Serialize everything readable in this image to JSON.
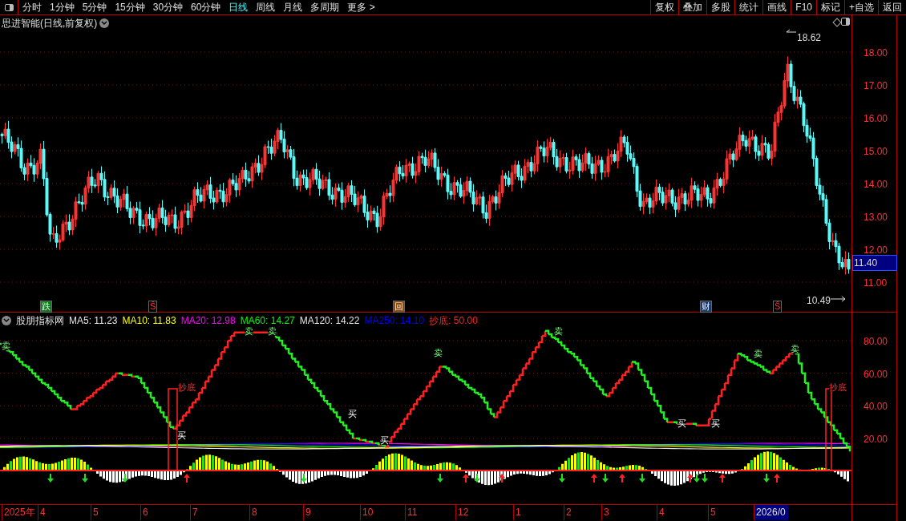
{
  "toolbar": {
    "periods": [
      {
        "label": "分时",
        "selected": false
      },
      {
        "label": "1分钟",
        "selected": false
      },
      {
        "label": "5分钟",
        "selected": false
      },
      {
        "label": "15分钟",
        "selected": false
      },
      {
        "label": "30分钟",
        "selected": false
      },
      {
        "label": "60分钟",
        "selected": false
      },
      {
        "label": "日线",
        "selected": true
      },
      {
        "label": "周线",
        "selected": false
      },
      {
        "label": "月线",
        "selected": false
      },
      {
        "label": "多周期",
        "selected": false
      },
      {
        "label": "更多 >",
        "selected": false
      }
    ],
    "buttons": [
      "复权",
      "叠加",
      "多股",
      "统计",
      "画线",
      "F10",
      "标记",
      "+自选",
      "返回"
    ]
  },
  "price_panel": {
    "title": "思进智能(日线,前复权)",
    "high_label": "18.62",
    "low_label": "10.49",
    "current_price": "11.40",
    "yticks": [
      "18.00",
      "17.00",
      "16.00",
      "15.00",
      "14.00",
      "13.00",
      "12.00",
      "11.00"
    ],
    "markers": [
      {
        "text": "跌",
        "color": "#0a7a1a"
      },
      {
        "text": "Ŝ",
        "color": "#000000"
      },
      {
        "text": "回",
        "color": "#8a4a10"
      },
      {
        "text": "财",
        "color": "#1a3a6a"
      },
      {
        "text": "Ŝ",
        "color": "#000000"
      }
    ]
  },
  "indicator_panel": {
    "name": "股朋指标网",
    "legend": [
      {
        "text": "MA5: 11.23",
        "color": "#e6e6e6"
      },
      {
        "text": "MA10: 11.83",
        "color": "#ffff00"
      },
      {
        "text": "MA20: 12.98",
        "color": "#ff00ff"
      },
      {
        "text": "MA60: 14.27",
        "color": "#00ff00"
      },
      {
        "text": "MA120: 14.22",
        "color": "#e6e6e6"
      },
      {
        "text": "MA250: 14.10",
        "color": "#0000ff"
      },
      {
        "text": "抄底: 50.00",
        "color": "#ff2020"
      }
    ],
    "yticks": [
      "80.00",
      "60.00",
      "40.00",
      "20.00"
    ],
    "signals": [
      {
        "text": "卖",
        "kind": "sell"
      },
      {
        "text": "卖",
        "kind": "sell"
      },
      {
        "text": "卖",
        "kind": "sell"
      },
      {
        "text": "卖",
        "kind": "sell"
      },
      {
        "text": "卖",
        "kind": "sell"
      },
      {
        "text": "卖",
        "kind": "sell"
      },
      {
        "text": "卖",
        "kind": "sell"
      },
      {
        "text": "抄底",
        "kind": "bottom"
      },
      {
        "text": "抄底",
        "kind": "bottom"
      },
      {
        "text": "买",
        "kind": "buy"
      },
      {
        "text": "买",
        "kind": "buy"
      },
      {
        "text": "买",
        "kind": "buy"
      },
      {
        "text": "买",
        "kind": "buy"
      },
      {
        "text": "买",
        "kind": "buy"
      }
    ]
  },
  "time_axis": [
    {
      "label": "2025年",
      "selected": false
    },
    {
      "label": "4",
      "selected": false
    },
    {
      "label": "5",
      "selected": false
    },
    {
      "label": "6",
      "selected": false
    },
    {
      "label": "7",
      "selected": false
    },
    {
      "label": "8",
      "selected": false
    },
    {
      "label": "9",
      "selected": false
    },
    {
      "label": "10",
      "selected": false
    },
    {
      "label": "11",
      "selected": false
    },
    {
      "label": "12",
      "selected": false
    },
    {
      "label": "1",
      "selected": false
    },
    {
      "label": "2",
      "selected": false
    },
    {
      "label": "3",
      "selected": false
    },
    {
      "label": "4",
      "selected": false
    },
    {
      "label": "5",
      "selected": false
    },
    {
      "label": "2026/0",
      "selected": true
    }
  ]
}
